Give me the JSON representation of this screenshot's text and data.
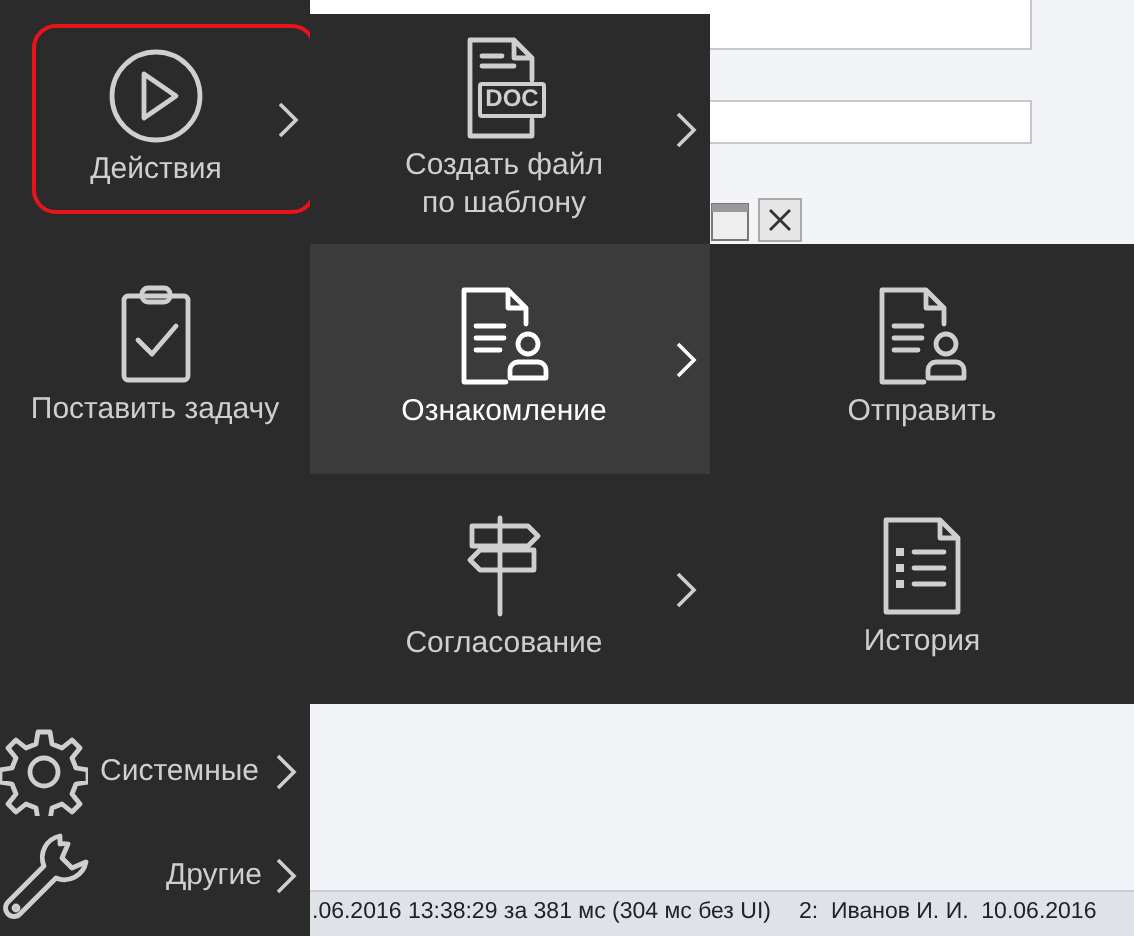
{
  "status_bar": {
    "left": ".06.2016 13:38:29 за 381 мс (304 мс без UI)",
    "right": "2:  Иванов И. И.  10.06.2016"
  },
  "menu": {
    "main": [
      {
        "label": "Действия",
        "kind": "tile",
        "selected": true,
        "submenu": true
      },
      {
        "label": "Поставить задачу",
        "kind": "tile",
        "selected": false,
        "submenu": false
      },
      {
        "label": "Системные",
        "kind": "row",
        "selected": false,
        "submenu": true
      },
      {
        "label": "Другие",
        "kind": "row",
        "selected": false,
        "submenu": true
      }
    ],
    "actions": [
      {
        "label": "Создать файл\nпо шаблону",
        "icon_label": "DOC",
        "selected": false,
        "submenu": true
      },
      {
        "label": "Ознакомление",
        "selected": true,
        "submenu": true
      },
      {
        "label": "Согласование",
        "selected": false,
        "submenu": true
      }
    ],
    "familiarization": [
      {
        "label": "Отправить",
        "selected": false
      },
      {
        "label": "История",
        "selected": false
      }
    ]
  }
}
